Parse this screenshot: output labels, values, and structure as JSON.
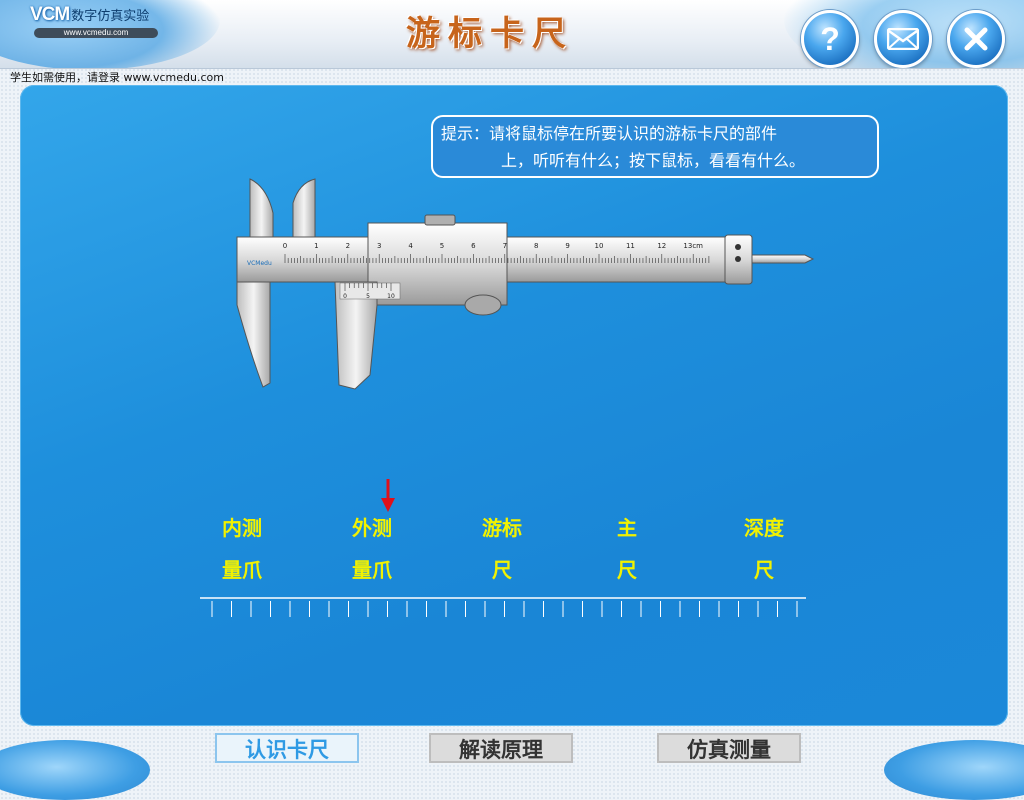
{
  "header": {
    "brand": "VCM",
    "brand_subtitle": "数字仿真实验",
    "brand_url": "www.vcmedu.com",
    "title": "游标卡尺",
    "buttons": [
      {
        "icon": "question-mark-icon",
        "label": "?"
      },
      {
        "icon": "envelope-icon"
      },
      {
        "icon": "close-icon"
      }
    ]
  },
  "login_note": "学生如需使用，请登录 www.vcmedu.com",
  "hint": {
    "line1": "提示：请将鼠标停在所要认识的游标卡尺的部件",
    "line2": "上，听听有什么；按下鼠标，看看有什么。"
  },
  "caliper": {
    "logo_text": "VCMedu",
    "main_scale_numbers": [
      "0",
      "1",
      "2",
      "3",
      "4",
      "5",
      "6",
      "7",
      "8",
      "9",
      "10",
      "11",
      "12",
      "13cm"
    ],
    "vernier_numbers": [
      "0",
      "5",
      "10"
    ]
  },
  "parts": [
    {
      "line1": "内测",
      "line2": "量爪"
    },
    {
      "line1": "外测",
      "line2": "量爪"
    },
    {
      "line1": "游标",
      "line2": "尺"
    },
    {
      "line1": "主",
      "line2": "尺"
    },
    {
      "line1": "深度",
      "line2": "尺"
    }
  ],
  "indicator": {
    "target_part": "外测量爪",
    "color": "#e0101a"
  },
  "tabs": [
    {
      "label": "认识卡尺",
      "active": true
    },
    {
      "label": "解读原理",
      "active": false
    },
    {
      "label": "仿真测量",
      "active": false
    }
  ],
  "colors": {
    "panel": "#1e8fdc",
    "label": "#f2f200",
    "title": "#c7641b"
  }
}
